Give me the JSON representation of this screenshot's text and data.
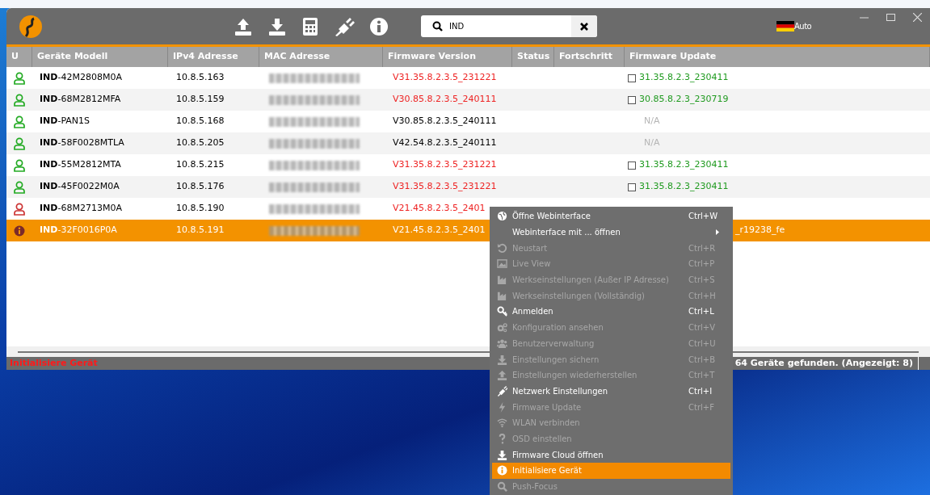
{
  "toolbar": {
    "search": {
      "value": "IND"
    },
    "language": "Auto"
  },
  "table": {
    "columns": [
      "U",
      "Geräte Modell",
      "IPv4 Adresse",
      "MAC Adresse",
      "Firmware Version",
      "Status",
      "Fortschritt",
      "Firmware Update"
    ],
    "rows": [
      {
        "kind": "user",
        "color": "#22aa22",
        "prefix": "IND",
        "model": "-42M2808M0A",
        "ip": "10.8.5.163",
        "firmware": "V31.35.8.2.3.5_231221",
        "outdated": true,
        "update": {
          "kind": "offer",
          "checked": false,
          "text": "31.35.8.2.3_230411"
        },
        "selected": false
      },
      {
        "kind": "user",
        "color": "#22aa22",
        "prefix": "IND",
        "model": "-68M2812MFA",
        "ip": "10.8.5.159",
        "firmware": "V30.85.8.2.3.5_240111",
        "outdated": true,
        "update": {
          "kind": "offer",
          "checked": false,
          "text": "30.85.8.2.3_230719"
        },
        "selected": false
      },
      {
        "kind": "user",
        "color": "#22aa22",
        "prefix": "IND",
        "model": "-PAN1S",
        "ip": "10.8.5.168",
        "firmware": "V30.85.8.2.3.5_240111",
        "outdated": false,
        "update": {
          "kind": "na",
          "text": "N/A"
        },
        "selected": false
      },
      {
        "kind": "user",
        "color": "#22aa22",
        "prefix": "IND",
        "model": "-58F0028MTLA",
        "ip": "10.8.5.205",
        "firmware": "V42.54.8.2.3.5_240111",
        "outdated": false,
        "update": {
          "kind": "na",
          "text": "N/A"
        },
        "selected": false
      },
      {
        "kind": "user",
        "color": "#22aa22",
        "prefix": "IND",
        "model": "-55M2812MTA",
        "ip": "10.8.5.215",
        "firmware": "V31.35.8.2.3.5_231221",
        "outdated": true,
        "update": {
          "kind": "offer",
          "checked": false,
          "text": "31.35.8.2.3_230411"
        },
        "selected": false
      },
      {
        "kind": "user",
        "color": "#22aa22",
        "prefix": "IND",
        "model": "-45F0022M0A",
        "ip": "10.8.5.176",
        "firmware": "V31.35.8.2.3.5_231221",
        "outdated": true,
        "update": {
          "kind": "offer",
          "checked": false,
          "text": "31.35.8.2.3_230411"
        },
        "selected": false
      },
      {
        "kind": "user",
        "color": "#cc3333",
        "prefix": "IND",
        "model": "-68M2713M0A",
        "ip": "10.8.5.190",
        "firmware": "V21.45.8.2.3.5_2401",
        "outdated": true,
        "selected": false
      },
      {
        "kind": "info",
        "color": "#7a2a2a",
        "prefix": "IND",
        "model": "-32F0016P0A",
        "ip": "10.8.5.191",
        "firmware": "V21.45.8.2.3.5_2401",
        "outdated": true,
        "update": {
          "kind": "hidden",
          "text": "_r19238_fe"
        },
        "selected": true
      }
    ]
  },
  "status_bar": {
    "message": "Initialisiere Gerät",
    "count": "64 Geräte gefunden. (Angezeigt: 8)"
  },
  "context_menu": [
    {
      "label": "Öffne Webinterface",
      "shortcut": "Ctrl+W",
      "disabled": false,
      "selected": false
    },
    {
      "label": "Webinterface mit ... öffnen",
      "submenu": true,
      "disabled": false,
      "selected": false
    },
    {
      "label": "Neustart",
      "shortcut": "Ctrl+R",
      "disabled": true,
      "selected": false
    },
    {
      "label": "Live View",
      "shortcut": "Ctrl+P",
      "disabled": true,
      "selected": false
    },
    {
      "label": "Werkseinstellungen (Außer IP Adresse)",
      "shortcut": "Ctrl+S",
      "disabled": true,
      "selected": false
    },
    {
      "label": "Werkseinstellungen (Vollständig)",
      "shortcut": "Ctrl+H",
      "disabled": true,
      "selected": false
    },
    {
      "label": "Anmelden",
      "shortcut": "Ctrl+L",
      "disabled": false,
      "selected": false
    },
    {
      "label": "Konfiguration ansehen",
      "shortcut": "Ctrl+V",
      "disabled": true,
      "selected": false
    },
    {
      "label": "Benutzerverwaltung",
      "shortcut": "Ctrl+U",
      "disabled": true,
      "selected": false
    },
    {
      "label": "Einstellungen sichern",
      "shortcut": "Ctrl+B",
      "disabled": true,
      "selected": false
    },
    {
      "label": "Einstellungen wiederherstellen",
      "shortcut": "Ctrl+T",
      "disabled": true,
      "selected": false
    },
    {
      "label": "Netzwerk Einstellungen",
      "shortcut": "Ctrl+I",
      "disabled": false,
      "selected": false
    },
    {
      "label": "Firmware Update",
      "shortcut": "Ctrl+F",
      "disabled": true,
      "selected": false
    },
    {
      "label": "WLAN verbinden",
      "disabled": true,
      "selected": false
    },
    {
      "label": "OSD einstellen",
      "disabled": true,
      "selected": false
    },
    {
      "label": "Firmware Cloud öffnen",
      "disabled": false,
      "selected": false
    },
    {
      "label": "Initialisiere Gerät",
      "disabled": false,
      "selected": true
    },
    {
      "label": "Push-Focus",
      "disabled": true,
      "selected": false
    }
  ]
}
